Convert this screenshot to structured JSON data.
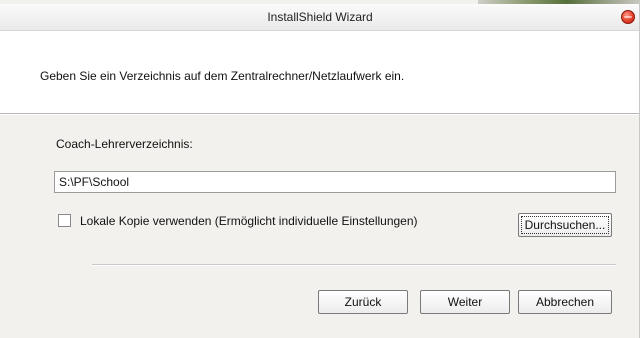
{
  "window": {
    "title": "InstallShield Wizard"
  },
  "header": {
    "instruction": "Geben Sie ein Verzeichnis auf dem Zentralrechner/Netzlaufwerk ein."
  },
  "form": {
    "directory_label": "Coach-Lehrerverzeichnis:",
    "directory_value": "S:\\PF\\School",
    "local_copy_label": "Lokale Kopie verwenden (Ermöglicht individuelle Einstellungen)",
    "local_copy_checked": false,
    "browse_label": "Durchsuchen..."
  },
  "buttons": {
    "back_label": "Zurück",
    "next_label": "Weiter",
    "cancel_label": "Abbrechen"
  },
  "icons": {
    "close": "close-icon"
  }
}
